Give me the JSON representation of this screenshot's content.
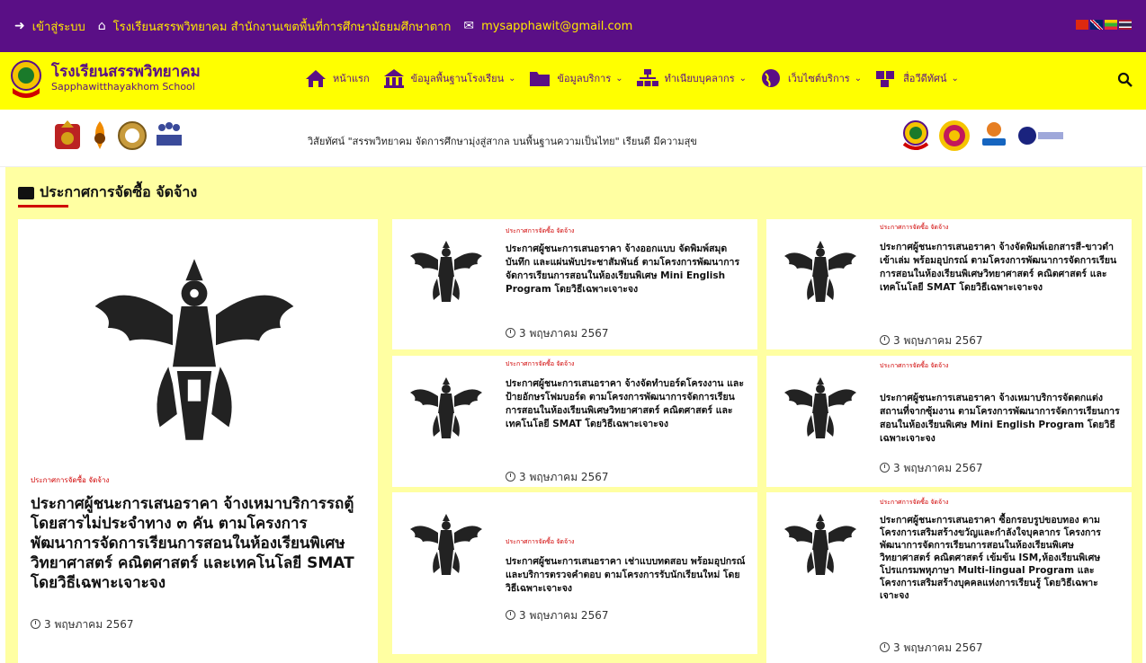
{
  "topbar": {
    "login": "เข้าสู่ระบบ",
    "school_office": "โรงเรียนสรรพวิทยาคม สำนักงานเขตพื้นที่การศึกษามัธยมศึกษาตาก",
    "email": "mysapphawit@gmail.com"
  },
  "brand": {
    "name_th": "โรงเรียนสรรพวิทยาคม",
    "name_en": "Sapphawitthayakhom School"
  },
  "menu": [
    {
      "label": "หน้าแรก",
      "icon": "home-icon",
      "dropdown": false
    },
    {
      "label": "ข้อมูลพื้นฐานโรงเรียน",
      "icon": "school-info-icon",
      "dropdown": true
    },
    {
      "label": "ข้อมูลบริการ",
      "icon": "folder-icon",
      "dropdown": true
    },
    {
      "label": "ทำเนียบบุคลากร",
      "icon": "org-chart-icon",
      "dropdown": true
    },
    {
      "label": "เว็บไซต์บริการ",
      "icon": "globe-icon",
      "dropdown": true
    },
    {
      "label": "สื่อวีดีทัศน์",
      "icon": "video-icon",
      "dropdown": true
    }
  ],
  "vision": "วิสัยทัศน์ \"สรรพวิทยาคม จัดการศึกษามุ่งสู่สากล บนพื้นฐานความเป็นไทย\" เรียนดี มีความสุข",
  "section_title": "ประกาศการจัดซื้อ จัดจ้าง",
  "featured": {
    "category": "ประกาศการจัดซื้อ จัดจ้าง",
    "title": "ประกาศผู้ชนะการเสนอราคา จ้างเหมาบริการรถตู้โดยสารไม่ประจำทาง ๓ คัน ตามโครงการพัฒนาการจัดการเรียนการสอนในห้องเรียนพิเศษวิทยาศาสตร์ คณิตศาสตร์ และเทคโนโลยี SMAT โดยวิธีเฉพาะเจาะจง",
    "date": "3 พฤษภาคม 2567"
  },
  "cards": [
    {
      "category": "ประกาศการจัดซื้อ จัดจ้าง",
      "title": "ประกาศผู้ชนะการเสนอราคา จ้างออกแบบ จัดพิมพ์สมุดบันทึก และแผ่นพับประชาสัมพันธ์ ตามโครงการพัฒนาการจัดการเรียนการสอนในห้องเรียนพิเศษ Mini English Program โดยวิธีเฉพาะเจาะจง",
      "date": "3 พฤษภาคม 2567"
    },
    {
      "category": "ประกาศการจัดซื้อ จัดจ้าง",
      "title": "ประกาศผู้ชนะการเสนอราคา จ้างจัดพิมพ์เอกสารสี-ขาวดำ เข้าเล่ม พร้อมอุปกรณ์ ตามโครงการพัฒนาการจัดการเรียนการสอนในห้องเรียนพิเศษวิทยาศาสตร์ คณิตศาสตร์ และเทคโนโลยี SMAT โดยวิธีเฉพาะเจาะจง",
      "date": "3 พฤษภาคม 2567"
    },
    {
      "category": "ประกาศการจัดซื้อ จัดจ้าง",
      "title": "ประกาศผู้ชนะการเสนอราคา จ้างจัดทำบอร์ดโครงงาน และป้ายอักษรโฟมบอร์ด ตามโครงการพัฒนาการจัดการเรียนการสอนในห้องเรียนพิเศษวิทยาศาสตร์ คณิตศาสตร์ และเทคโนโลยี SMAT โดยวิธีเฉพาะเจาะจง",
      "date": "3 พฤษภาคม 2567"
    },
    {
      "category": "ประกาศการจัดซื้อ จัดจ้าง",
      "title": "ประกาศผู้ชนะการเสนอราคา จ้างเหมาบริการจัดตกแต่งสถานที่จากซุ้มงาน ตามโครงการพัฒนาการจัดการเรียนการสอนในห้องเรียนพิเศษ Mini English Program โดยวิธีเฉพาะเจาะจง",
      "date": "3 พฤษภาคม 2567"
    },
    {
      "category": "ประกาศการจัดซื้อ จัดจ้าง",
      "title": "ประกาศผู้ชนะการเสนอราคา เช่าแบบทดสอบ พร้อมอุปกรณ์และบริการตรวจคำตอบ ตามโครงการรับนักเรียนใหม่ โดยวิธีเฉพาะเจาะจง",
      "date": "3 พฤษภาคม 2567"
    },
    {
      "category": "ประกาศการจัดซื้อ จัดจ้าง",
      "title": "ประกาศผู้ชนะการเสนอราคา ซื้อกรอบรูปขอบทอง ตามโครงการเสริมสร้างขวัญและกำลังใจบุคลากร โครงการพัฒนาการจัดการเรียนการสอนในห้องเรียนพิเศษวิทยาศาสตร์ คณิตศาสตร์ เข้มข้น ISM,ห้องเรียนพิเศษโปรแกรมพหุภาษา Multi-lingual Program และโครงการเสริมสร้างบุคคลแห่งการเรียนรู้ โดยวิธีเฉพาะเจาะจง",
      "date": "3 พฤษภาคม 2567"
    }
  ],
  "colors": {
    "topbar_bg": "#5a0f86",
    "topbar_text": "#ffe800",
    "nav_bg": "#ffff00",
    "content_bg": "#ffffa2",
    "accent_red": "#d00000"
  }
}
